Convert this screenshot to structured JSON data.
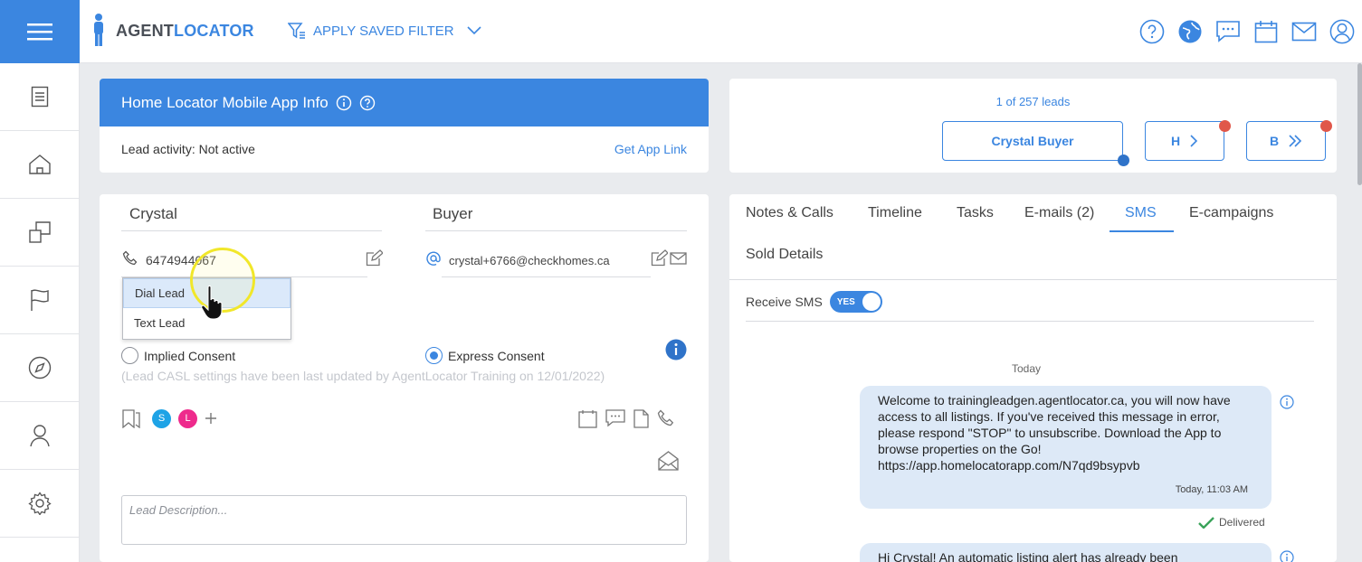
{
  "app": {
    "logo_left": "AGENT",
    "logo_right": "LOCATOR",
    "filter_label": "APPLY SAVED FILTER"
  },
  "top_icons": [
    "help-icon",
    "globe-icon",
    "chat-icon",
    "calendar-icon",
    "mail-icon",
    "user-icon"
  ],
  "sidebar": [
    "document-icon",
    "home-icon",
    "copy-icon",
    "flag-icon",
    "compass-icon",
    "person-icon",
    "gear-icon"
  ],
  "app_info": {
    "title": "Home Locator Mobile App Info",
    "activity_label": "Lead activity:",
    "activity_value": "Not active",
    "link": "Get App Link"
  },
  "nav": {
    "count": "1 of 257 leads",
    "current": "Crystal Buyer",
    "prev": "H",
    "next": "B"
  },
  "lead": {
    "first_name": "Crystal",
    "last_name": "Buyer",
    "phone": "6474944067",
    "email": "crystal+6766@checkhomes.ca",
    "dropdown": [
      "Dial Lead",
      "Text Lead"
    ],
    "implied": "Implied Consent",
    "express": "Express Consent",
    "casl_note": "(Lead CASL settings have been last updated by AgentLocator Training on 12/01/2022)",
    "avatars": [
      {
        "letter": "S",
        "color": "#1ea3e6"
      },
      {
        "letter": "L",
        "color": "#ee2a8c"
      }
    ],
    "description_placeholder": "Lead Description..."
  },
  "tabs": [
    "Notes & Calls",
    "Timeline",
    "Tasks",
    "E-mails (2)",
    "SMS",
    "E-campaigns",
    "Sold Details"
  ],
  "sms": {
    "receive_label": "Receive SMS",
    "toggle": "YES",
    "date_label": "Today",
    "message": "Welcome to trainingleadgen.agentlocator.ca, you will now have access to all listings. If you've received this message in error, please respond \"STOP\" to unsubscribe. Download the App to browse properties on the Go! https://app.homelocatorapp.com/N7qd9bsypvb",
    "time": "Today, 11:03 AM",
    "status": "Delivered",
    "second_message": "Hi Crystal! An automatic listing alert has already been"
  },
  "colors": {
    "accent": "#3b86e0",
    "red_dot": "#e0574a"
  }
}
